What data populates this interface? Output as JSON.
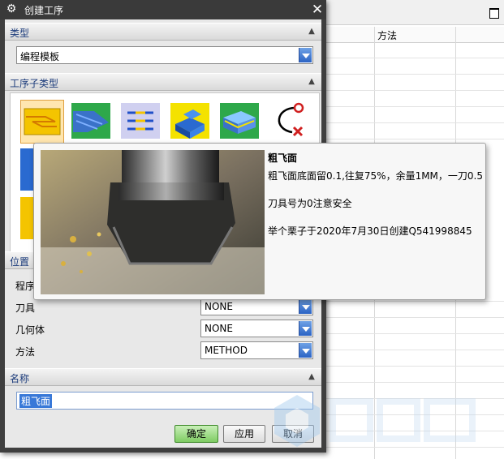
{
  "background_table": {
    "column_header": "方法"
  },
  "dialog": {
    "title": "创建工序",
    "close_symbol": "✕"
  },
  "type_section": {
    "label": "类型",
    "selected_value": "编程模板"
  },
  "subtype_section": {
    "label": "工序子类型",
    "icons": [
      "planar-face-mill-icon",
      "face-mill-area-icon",
      "line-pattern-icon",
      "cavity-block-icon",
      "layered-block-icon",
      "curve-path-point-icon"
    ]
  },
  "location_section": {
    "label": "位置",
    "program_label": "程序",
    "tool_label": "刀具",
    "tool_value": "NONE",
    "geometry_label": "几何体",
    "geometry_value": "NONE",
    "method_label": "方法",
    "method_value": "METHOD"
  },
  "name_section": {
    "label": "名称",
    "value": "粗飞面"
  },
  "buttons": {
    "ok": "确定",
    "apply": "应用",
    "cancel": "取消"
  },
  "tooltip": {
    "title": "粗飞面",
    "line1": "粗飞面底面留0.1,往复75%，余量1MM，一刀0.5",
    "line2": "刀具号为0注意安全",
    "line3": "举个栗子于2020年7月30日创建Q541998845"
  },
  "colors": {
    "accent_blue": "#2b63c4",
    "ok_green": "#7fcc63",
    "selection": "#3878d8"
  }
}
